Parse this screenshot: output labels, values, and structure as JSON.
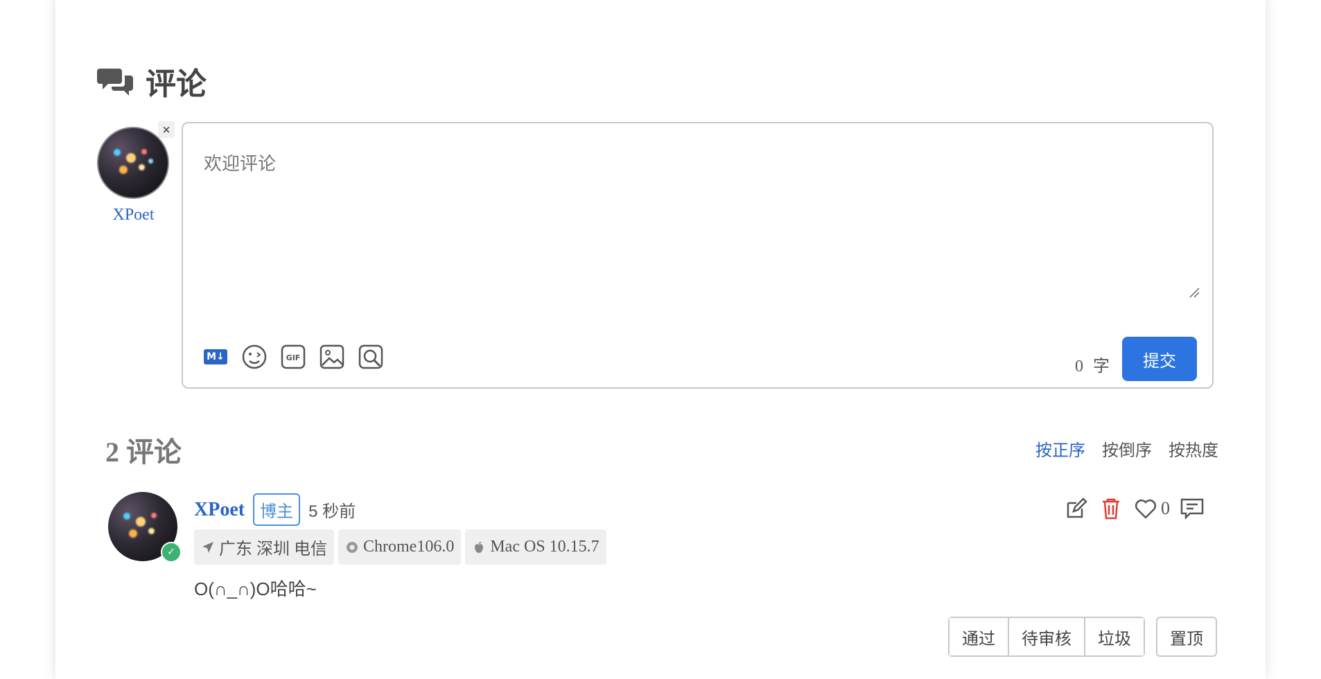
{
  "section": {
    "title": "评论"
  },
  "composer": {
    "user_name": "XPoet",
    "remove_label": "×",
    "placeholder": "欢迎评论",
    "toolbar": [
      {
        "icon": "markdown-icon"
      },
      {
        "icon": "emoji-icon"
      },
      {
        "icon": "gif-icon"
      },
      {
        "icon": "image-icon"
      },
      {
        "icon": "preview-icon"
      }
    ],
    "word_count": "0",
    "word_unit": "字",
    "submit_label": "提交"
  },
  "comments_header": {
    "count_label": "2 评论",
    "sort_options": [
      "按正序",
      "按倒序",
      "按热度"
    ],
    "active_sort": "按正序"
  },
  "comment": {
    "author": "XPoet",
    "badge": "博主",
    "time": "5 秒前",
    "location": "广东 深圳 电信",
    "browser": "Chrome106.0",
    "os": "Mac OS 10.15.7",
    "content": "O(∩_∩)O哈哈~",
    "likes": "0",
    "moderation": [
      "通过",
      "待审核",
      "垃圾"
    ],
    "pin_label": "置顶",
    "delete_color": "#e53935"
  },
  "colors": {
    "accent": "#2a64c6",
    "submit": "#2c74e0",
    "verified": "#3cb371"
  }
}
